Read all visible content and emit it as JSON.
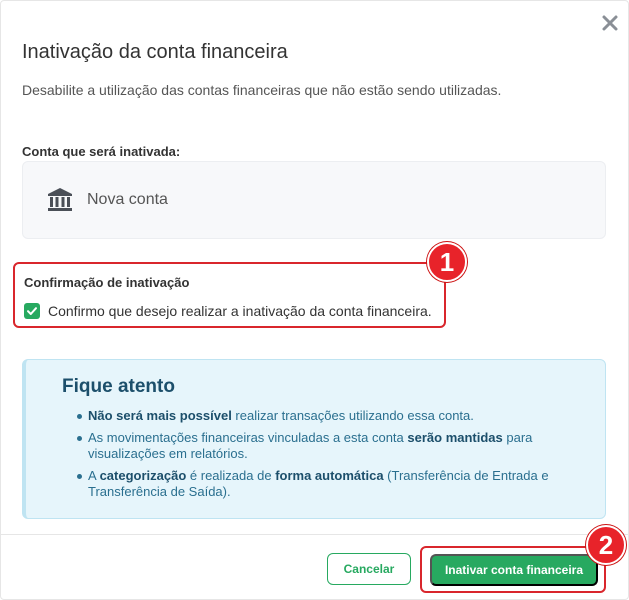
{
  "modal": {
    "title": "Inativação da conta financeira",
    "subtitle": "Desabilite a utilização das contas financeiras que não estão sendo utilizadas."
  },
  "account": {
    "label": "Conta que será inativada:",
    "name": "Nova conta",
    "icon": "bank-icon"
  },
  "confirmation": {
    "title": "Confirmação de inativação",
    "checkbox_label": "Confirmo que desejo realizar a inativação da conta financeira.",
    "checked": true
  },
  "alert": {
    "title": "Fique atento",
    "items": [
      [
        {
          "text": "Não será mais possível",
          "bold": true
        },
        {
          "text": " realizar transações utilizando essa conta.",
          "bold": false
        }
      ],
      [
        {
          "text": "As movimentações financeiras vinculadas a esta conta ",
          "bold": false
        },
        {
          "text": "serão mantidas",
          "bold": true
        },
        {
          "text": " para visualizações em relatórios.",
          "bold": false
        }
      ],
      [
        {
          "text": "A ",
          "bold": false
        },
        {
          "text": "categorização",
          "bold": true
        },
        {
          "text": " é realizada de ",
          "bold": false
        },
        {
          "text": "forma automática",
          "bold": true
        },
        {
          "text": " (Transferência de Entrada e Transferência de Saída).",
          "bold": false
        }
      ]
    ]
  },
  "annotations": {
    "badge_1": "1",
    "badge_2": "2"
  },
  "footer": {
    "cancel_label": "Cancelar",
    "confirm_label": "Inativar conta financeira"
  },
  "colors": {
    "primary_green": "#27a960",
    "highlight_red": "#d9262c",
    "alert_bg": "#e6f5fb",
    "alert_text": "#2a6f8f"
  }
}
